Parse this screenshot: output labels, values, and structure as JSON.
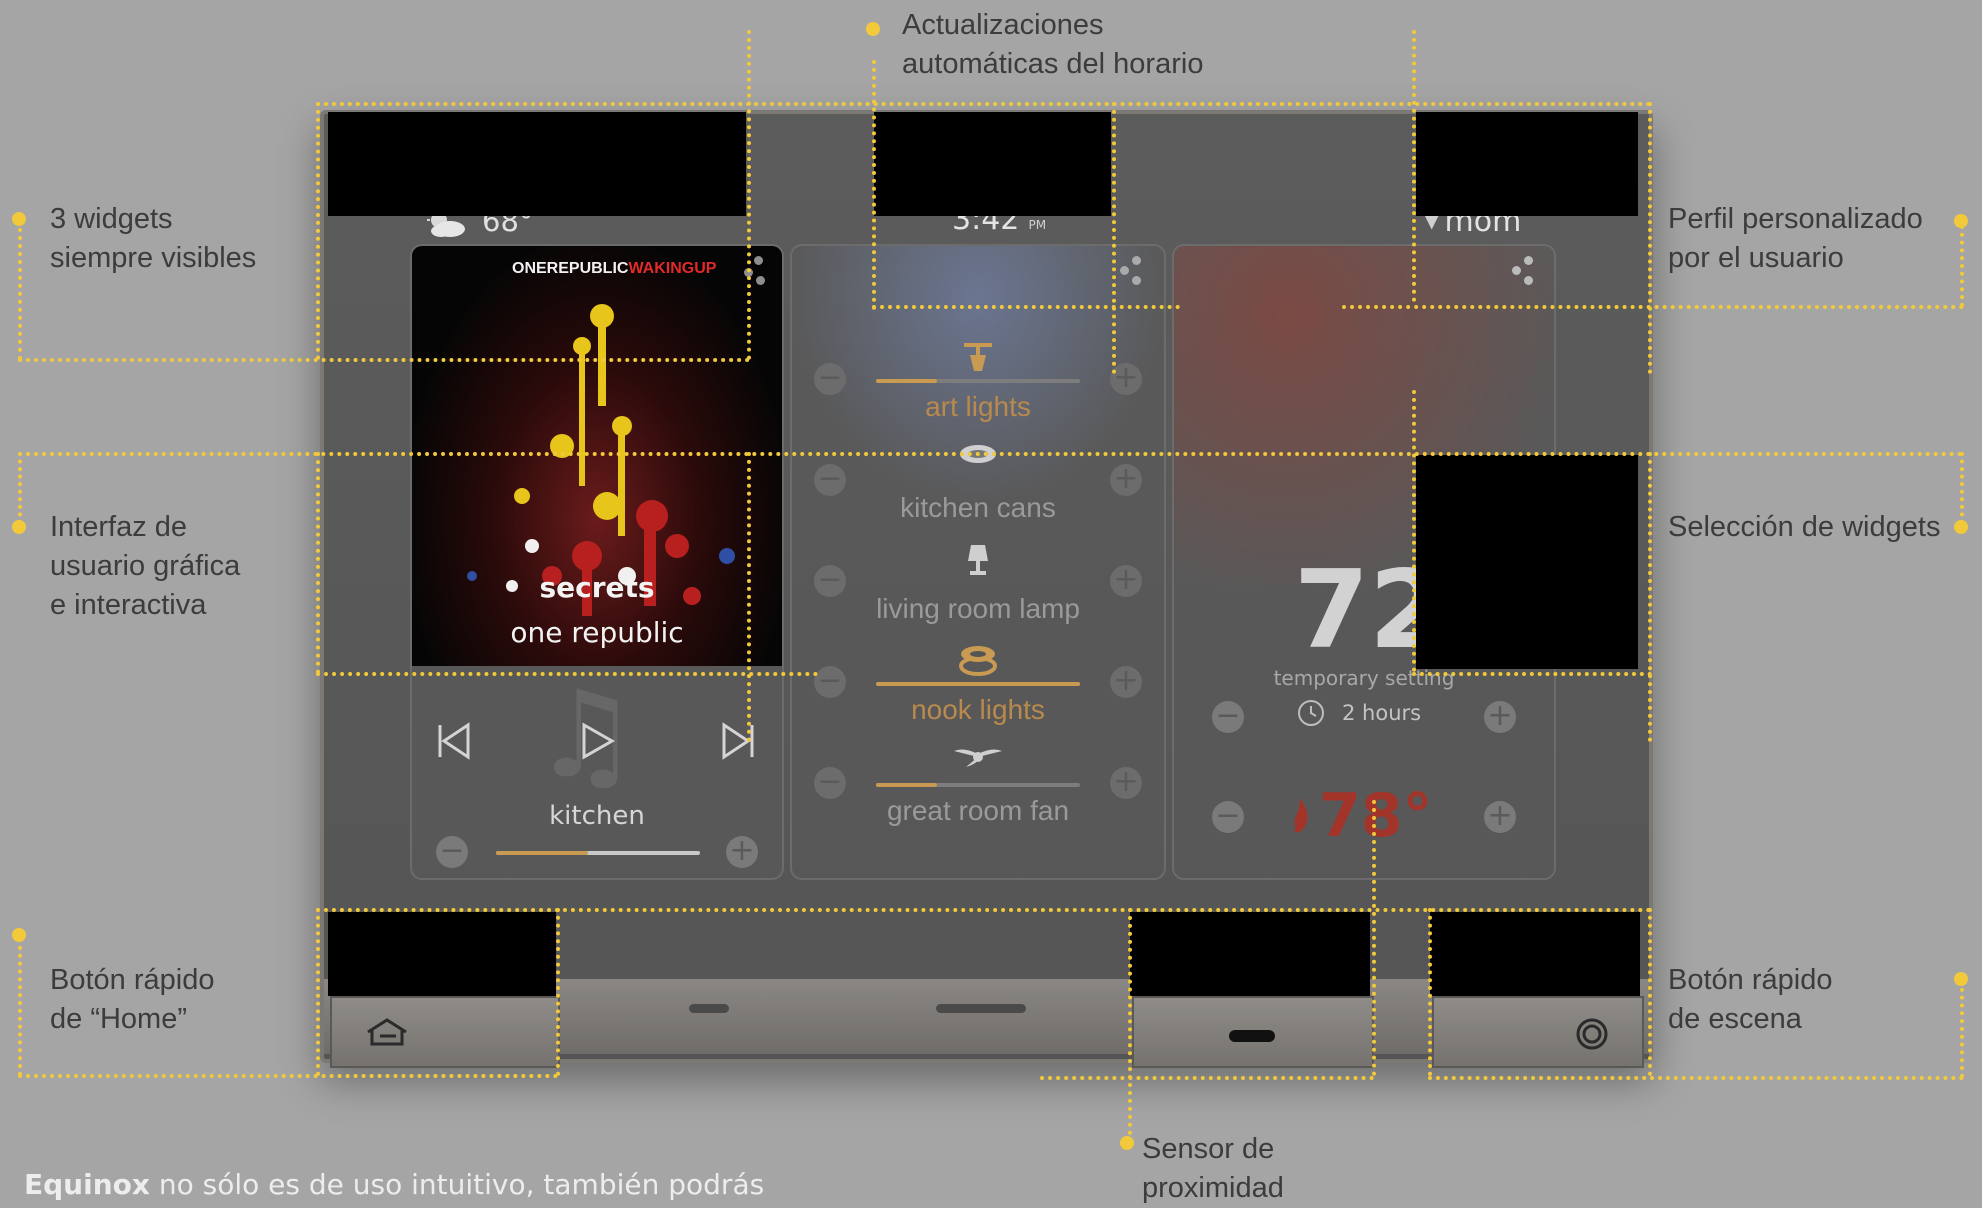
{
  "callouts": {
    "auto_updates": {
      "line1": "Actualizaciones",
      "line2": "automáticas del horario"
    },
    "widgets": {
      "line1": "3 widgets",
      "line2": "siempre visibles"
    },
    "profile": {
      "line1": "Perfil personalizado",
      "line2": "por el usuario"
    },
    "gui": {
      "line1": "Interfaz de",
      "line2": "usuario gráfica",
      "line3": "e interactiva"
    },
    "widget_select": {
      "line1": "Selección de widgets"
    },
    "home_button": {
      "line1": "Botón rápido",
      "line2": "de “Home”"
    },
    "scene_button": {
      "line1": "Botón rápido",
      "line2": "de escena"
    },
    "proximity": {
      "line1": "Sensor de",
      "line2": "proximidad"
    }
  },
  "caption": {
    "brand": "Equinox",
    "text": " no sólo es de uso intuitivo, también podrás"
  },
  "device": {
    "status_bar": {
      "weather_icon": "partly-cloudy-icon",
      "temperature": "68°",
      "time": "3:42",
      "meridiem": "PM",
      "user": "mom",
      "user_arrow": "▼"
    },
    "music": {
      "album_artist_a": "ONEREPUBLIC",
      "album_title_b": "WAKINGUP",
      "song": "secrets",
      "artist": "one republic",
      "room": "kitchen",
      "volume": 0.45,
      "prev_icon": "skip-previous-icon",
      "play_icon": "play-icon",
      "next_icon": "skip-next-icon"
    },
    "lights": {
      "items": [
        {
          "label": "art lights",
          "icon": "track-light-icon",
          "level": 0.3,
          "on": true
        },
        {
          "label": "kitchen cans",
          "icon": "recessed-light-icon",
          "level": 0,
          "on": false
        },
        {
          "label": "living room lamp",
          "icon": "lamp-icon",
          "level": 0,
          "on": false
        },
        {
          "label": "nook lights",
          "icon": "pendant-light-icon",
          "level": 1,
          "on": true
        },
        {
          "label": "great room fan",
          "icon": "fan-icon",
          "level": 0.3,
          "on": false
        }
      ]
    },
    "climate": {
      "setpoint": "72",
      "degree": "°",
      "mode": "temporary setting",
      "duration": "2 hours",
      "outside": "78°",
      "flame_icon": "flame-icon",
      "clock_icon": "clock-icon"
    },
    "buttons": {
      "home_icon": "home-icon",
      "scene_icon": "scene-icon"
    }
  },
  "colors": {
    "accent": "#f2c93a",
    "light_on": "#c89a52",
    "heat": "#a3342a"
  }
}
